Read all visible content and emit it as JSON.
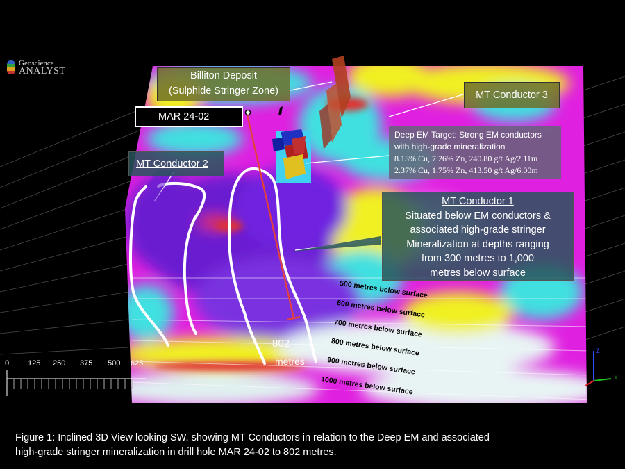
{
  "logo": {
    "line1": "Geoscience",
    "line2": "ANALYST"
  },
  "labels": {
    "billiton_line1": "Billiton Deposit",
    "billiton_line2": "(Sulphide Stringer Zone)",
    "mt3": "MT Conductor 3",
    "drillhole": "MAR 24-02",
    "mt2": "MT Conductor 2",
    "deep_em_line1": "Deep EM Target: Strong  EM conductors",
    "deep_em_line2": "with high-grade mineralization",
    "deep_em_line3": "8.13% Cu, 7.26% Zn, 240.80 g/t Ag/2.11m",
    "deep_em_line4": "2.37% Cu, 1.75% Zn, 413.50 g/t Ag/6.00m",
    "mt1_title": "MT Conductor 1",
    "mt1_line1": "Situated below EM conductors &",
    "mt1_line2": "associated high-grade stringer",
    "mt1_line3": "Mineralization at depths ranging",
    "mt1_line4": "from 300 metres to 1,000",
    "mt1_line5": "metres below surface",
    "depth_802": "802",
    "depth_unit": "metres"
  },
  "depths": [
    "500 metres below surface",
    "600 metres below surface",
    "700 metres below surface",
    "800 metres below surface",
    "900 metres below surface",
    "1000 metres below surface"
  ],
  "scale": [
    "0",
    "125",
    "250",
    "375",
    "500",
    "625"
  ],
  "axes": {
    "z": "Z",
    "y": "Y"
  },
  "caption": {
    "line1": "Figure 1: Inclined 3D View looking SW, showing MT Conductors in relation to the Deep EM and associated",
    "line2": "high-grade stringer mineralization in drill hole MAR 24-02 to 802 metres."
  },
  "colors": {
    "background": "#000000",
    "conductor_purple": "#6a1fd0",
    "magenta": "#e020e0",
    "yellow": "#f0f020",
    "cyan": "#40e0e0",
    "red": "#e03030",
    "drillhole": "#e04040"
  }
}
